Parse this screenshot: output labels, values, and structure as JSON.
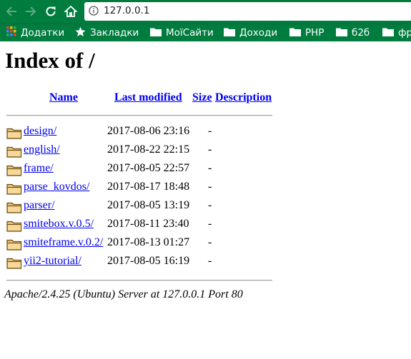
{
  "browser": {
    "url": "127.0.0.1",
    "bookmarks": [
      "Додатки",
      "Закладки",
      "МоїСайти",
      "Доходи",
      "PHP",
      "б2б",
      "фр"
    ]
  },
  "page": {
    "title": "Index of /",
    "columns": {
      "name": "Name",
      "last_modified": "Last modified",
      "size": "Size",
      "description": "Description"
    },
    "entries": [
      {
        "name": "design/",
        "modified": "2017-08-06 23:16",
        "size": "-"
      },
      {
        "name": "english/",
        "modified": "2017-08-22 22:15",
        "size": "-"
      },
      {
        "name": "frame/",
        "modified": "2017-08-05 22:57",
        "size": "-"
      },
      {
        "name": "parse_kovdos/",
        "modified": "2017-08-17 18:48",
        "size": "-"
      },
      {
        "name": "parser/",
        "modified": "2017-08-05 13:19",
        "size": "-"
      },
      {
        "name": "smitebox.v.0.5/",
        "modified": "2017-08-11 23:40",
        "size": "-"
      },
      {
        "name": "smiteframe.v.0.2/",
        "modified": "2017-08-13 01:27",
        "size": "-"
      },
      {
        "name": "yii2-tutorial/",
        "modified": "2017-08-05 16:19",
        "size": "-"
      }
    ],
    "footer": "Apache/2.4.25 (Ubuntu) Server at 127.0.0.1 Port 80"
  },
  "colors": {
    "chrome": "#007c3f",
    "link": "#0000ee"
  }
}
